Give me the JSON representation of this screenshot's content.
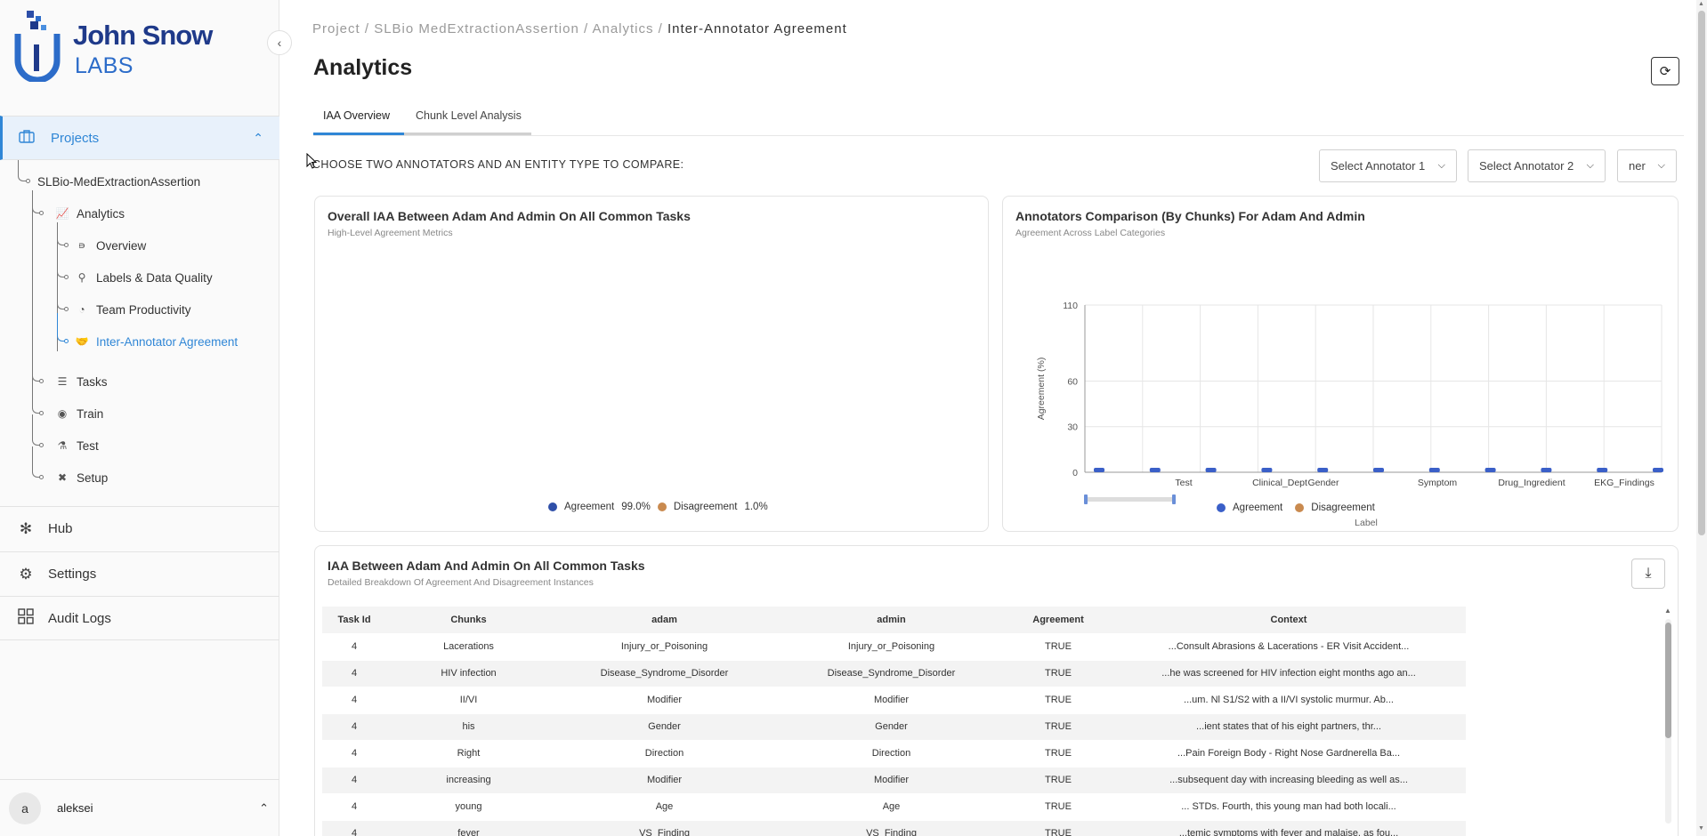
{
  "brand": {
    "name_line1": "John Snow",
    "name_line2": "LABS"
  },
  "sidebar": {
    "projects_label": "Projects",
    "project_name": "SLBio-MedExtractionAssertion",
    "analytics_label": "Analytics",
    "analytics_items": [
      {
        "label": "Overview",
        "icon": "bar-chart-icon"
      },
      {
        "label": "Labels & Data Quality",
        "icon": "bulb-icon"
      },
      {
        "label": "Team Productivity",
        "icon": "gauge-icon"
      },
      {
        "label": "Inter-Annotator Agreement",
        "icon": "handshake-icon"
      }
    ],
    "project_items": [
      {
        "label": "Tasks",
        "icon": "tasks-icon"
      },
      {
        "label": "Train",
        "icon": "brain-icon"
      },
      {
        "label": "Test",
        "icon": "flask-icon"
      },
      {
        "label": "Setup",
        "icon": "tools-icon"
      }
    ],
    "main_items": [
      {
        "label": "Hub",
        "icon": "hub-icon"
      },
      {
        "label": "Settings",
        "icon": "gear-icon"
      },
      {
        "label": "Audit Logs",
        "icon": "grid-icon"
      }
    ],
    "user": {
      "initial": "a",
      "name": "aleksei"
    }
  },
  "breadcrumb": {
    "part1": "Project / ",
    "part2": "SLBio MedExtractionAssertion / ",
    "part3": "Analytics / ",
    "current": "Inter-Annotator Agreement"
  },
  "page": {
    "title": "Analytics"
  },
  "tabs": [
    {
      "label": "IAA Overview",
      "active": true
    },
    {
      "label": "Chunk Level Analysis",
      "active": false
    }
  ],
  "filters": {
    "instruction": "CHOOSE TWO ANNOTATORS AND AN ENTITY TYPE TO COMPARE:",
    "annotator1": "Select Annotator 1",
    "annotator2": "Select Annotator 2",
    "entity_type": "ner"
  },
  "colors": {
    "accent": "#2f86d6",
    "agreement": "#3a5fc8",
    "disagreement": "#c98a4f"
  },
  "overall_card": {
    "title": "Overall IAA Between Adam And Admin On All Common Tasks",
    "subtitle": "High-Level Agreement Metrics",
    "legend": [
      {
        "label": "Agreement",
        "value": "99.0%"
      },
      {
        "label": "Disagreement",
        "value": "1.0%"
      }
    ]
  },
  "comparison_card": {
    "title": "Annotators Comparison (By Chunks) For Adam And Admin",
    "subtitle": "Agreement Across Label Categories",
    "legend": [
      {
        "label": "Agreement"
      },
      {
        "label": "Disagreement"
      }
    ]
  },
  "chart_data": {
    "type": "bar",
    "xlabel": "Label",
    "ylabel": "Agreement (%)",
    "ylim": [
      0,
      110
    ],
    "yticks": [
      0,
      30,
      60,
      110
    ],
    "x_tick_labels": [
      "Test",
      "Clinical_Dept",
      "Gender",
      "Symptom",
      "Drug_Ingredient",
      "EKG_Findings"
    ],
    "series": [
      {
        "name": "Agreement",
        "values": [
          1,
          1,
          1,
          1,
          1,
          1,
          1,
          1,
          1,
          1,
          1
        ]
      },
      {
        "name": "Disagreement",
        "values": [
          0,
          0,
          0,
          0,
          0,
          0,
          0,
          0,
          0,
          0,
          0
        ]
      }
    ],
    "grid": true,
    "legend": "bottom"
  },
  "table_card": {
    "title": "IAA Between Adam And Admin On All Common Tasks",
    "subtitle": "Detailed Breakdown Of Agreement And Disagreement Instances",
    "columns": [
      "Task Id",
      "Chunks",
      "adam",
      "admin",
      "Agreement",
      "Context"
    ],
    "rows": [
      [
        "4",
        "Lacerations",
        "Injury_or_Poisoning",
        "Injury_or_Poisoning",
        "TRUE",
        "...Consult Abrasions & Lacerations - ER Visit Accident..."
      ],
      [
        "4",
        "HIV infection",
        "Disease_Syndrome_Disorder",
        "Disease_Syndrome_Disorder",
        "TRUE",
        "...he was screened for HIV infection eight months ago an..."
      ],
      [
        "4",
        "II/VI",
        "Modifier",
        "Modifier",
        "TRUE",
        "...um. Nl S1/S2 with a II/VI systolic murmur. Ab..."
      ],
      [
        "4",
        "his",
        "Gender",
        "Gender",
        "TRUE",
        "...ient states that of his eight partners, thr..."
      ],
      [
        "4",
        "Right",
        "Direction",
        "Direction",
        "TRUE",
        "...Pain Foreign Body - Right Nose Gardnerella Ba..."
      ],
      [
        "4",
        "increasing",
        "Modifier",
        "Modifier",
        "TRUE",
        "...subsequent day with increasing bleeding as well as..."
      ],
      [
        "4",
        "young",
        "Age",
        "Age",
        "TRUE",
        "... STDs. Fourth, this young man had both locali..."
      ],
      [
        "4",
        "fever",
        "VS_Finding",
        "VS_Finding",
        "TRUE",
        "...temic symptoms with fever and malaise, as fou..."
      ]
    ]
  }
}
